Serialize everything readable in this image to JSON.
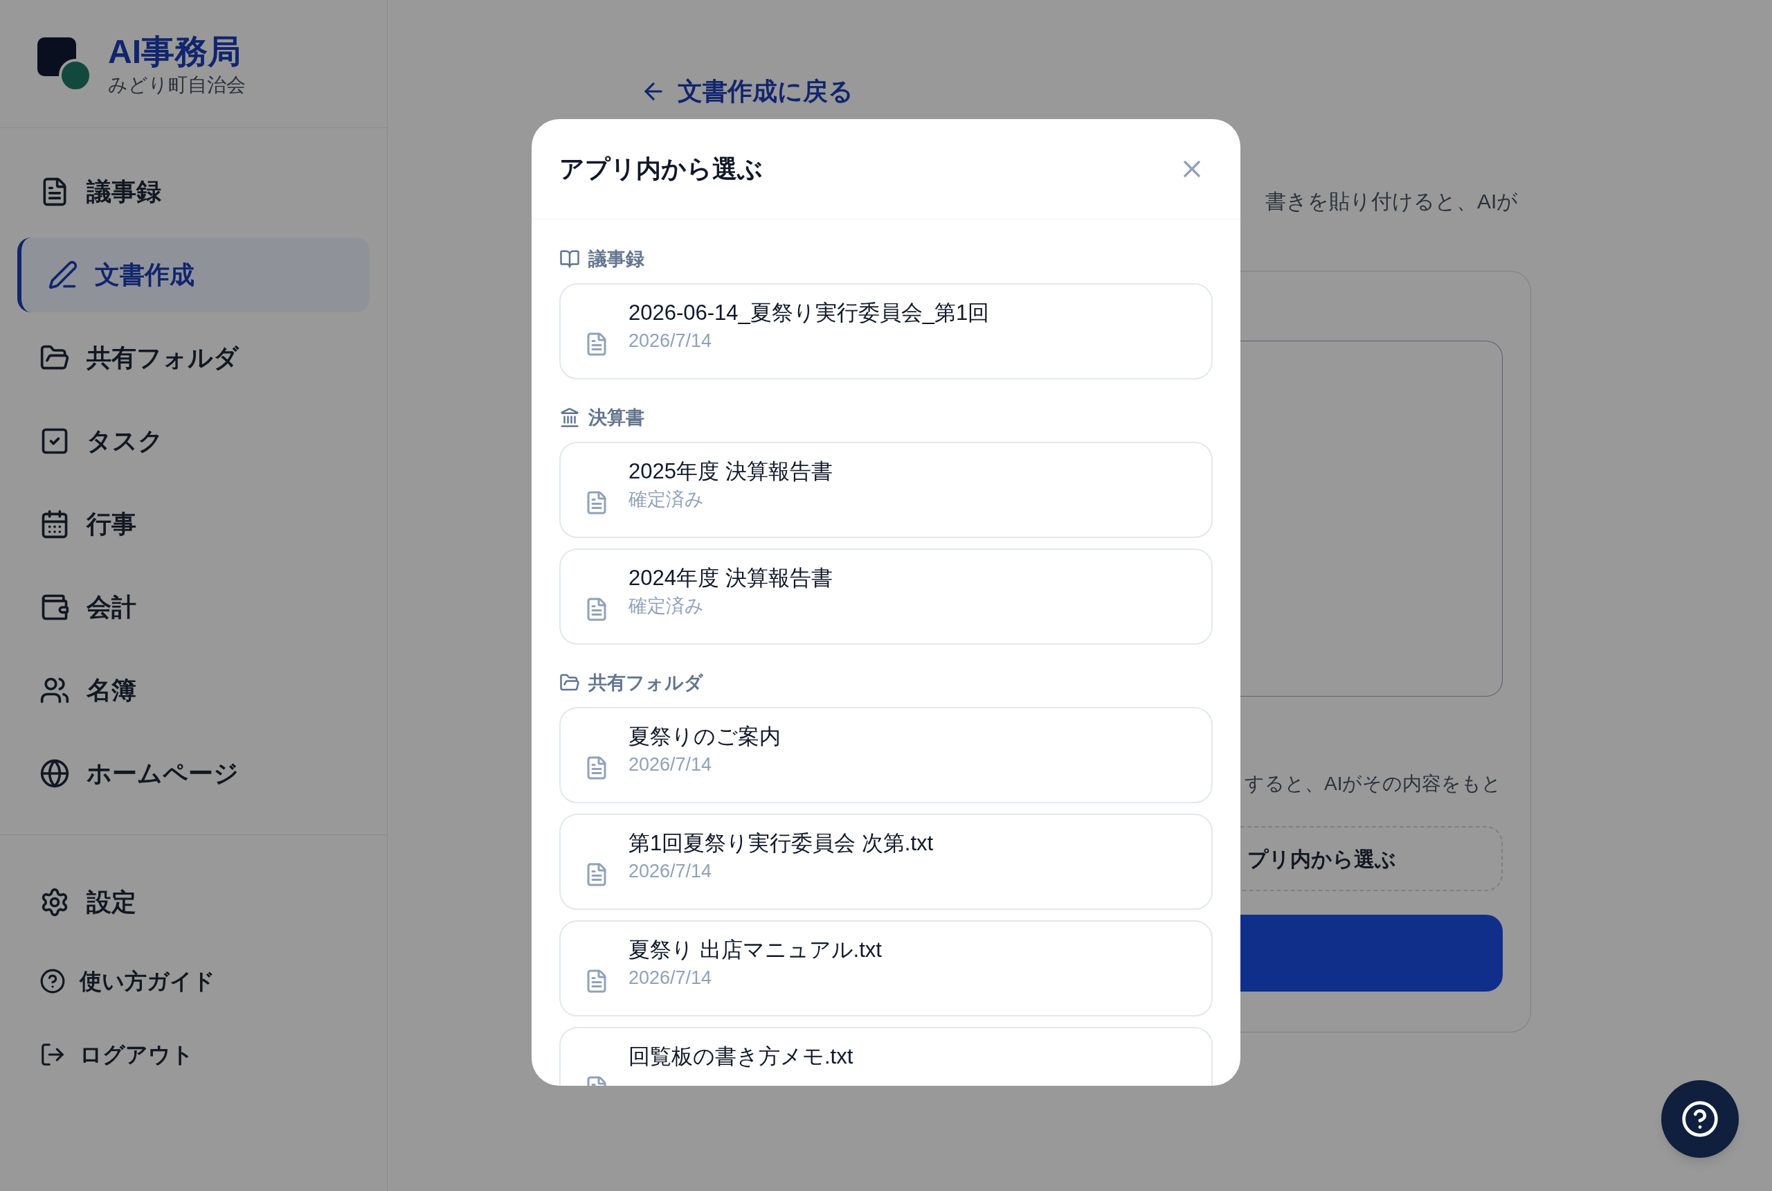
{
  "sidebar": {
    "brand": {
      "title": "AI事務局",
      "subtitle": "みどり町自治会"
    },
    "nav": [
      {
        "label": "議事録",
        "kind": "file",
        "selected": false
      },
      {
        "label": "文書作成",
        "kind": "pen",
        "selected": true
      },
      {
        "label": "共有フォルダ",
        "kind": "folder",
        "selected": false
      },
      {
        "label": "タスク",
        "kind": "check",
        "selected": false
      },
      {
        "label": "行事",
        "kind": "calendar",
        "selected": false
      },
      {
        "label": "会計",
        "kind": "wallet",
        "selected": false
      },
      {
        "label": "名簿",
        "kind": "users",
        "selected": false
      },
      {
        "label": "ホームページ",
        "kind": "globe",
        "selected": false
      }
    ],
    "footer": [
      {
        "label": "設定",
        "kind": "settings"
      },
      {
        "label": "使い方ガイド",
        "kind": "help"
      },
      {
        "label": "ログアウト",
        "kind": "logout"
      }
    ]
  },
  "main": {
    "back_link": "文書作成に戻る",
    "intro_text": "書きを貼り付けると、AIが",
    "upload_text": "すると、AIがその内容をもと",
    "pick_button": "プリ内から選ぶ"
  },
  "modal": {
    "title": "アプリ内から選ぶ",
    "sections": [
      {
        "heading": "議事録",
        "kind": "book",
        "items": [
          {
            "title": "2026-06-14_夏祭り実行委員会_第1回",
            "subtitle": "2026/7/14"
          }
        ]
      },
      {
        "heading": "決算書",
        "kind": "landmark",
        "items": [
          {
            "title": "2025年度 決算報告書",
            "subtitle": "確定済み"
          },
          {
            "title": "2024年度 決算報告書",
            "subtitle": "確定済み"
          }
        ]
      },
      {
        "heading": "共有フォルダ",
        "kind": "folder",
        "items": [
          {
            "title": "夏祭りのご案内",
            "subtitle": "2026/7/14"
          },
          {
            "title": "第1回夏祭り実行委員会 次第.txt",
            "subtitle": "2026/7/14"
          },
          {
            "title": "夏祭り 出店マニュアル.txt",
            "subtitle": "2026/7/14"
          },
          {
            "title": "回覧板の書き方メモ.txt"
          }
        ]
      }
    ]
  }
}
